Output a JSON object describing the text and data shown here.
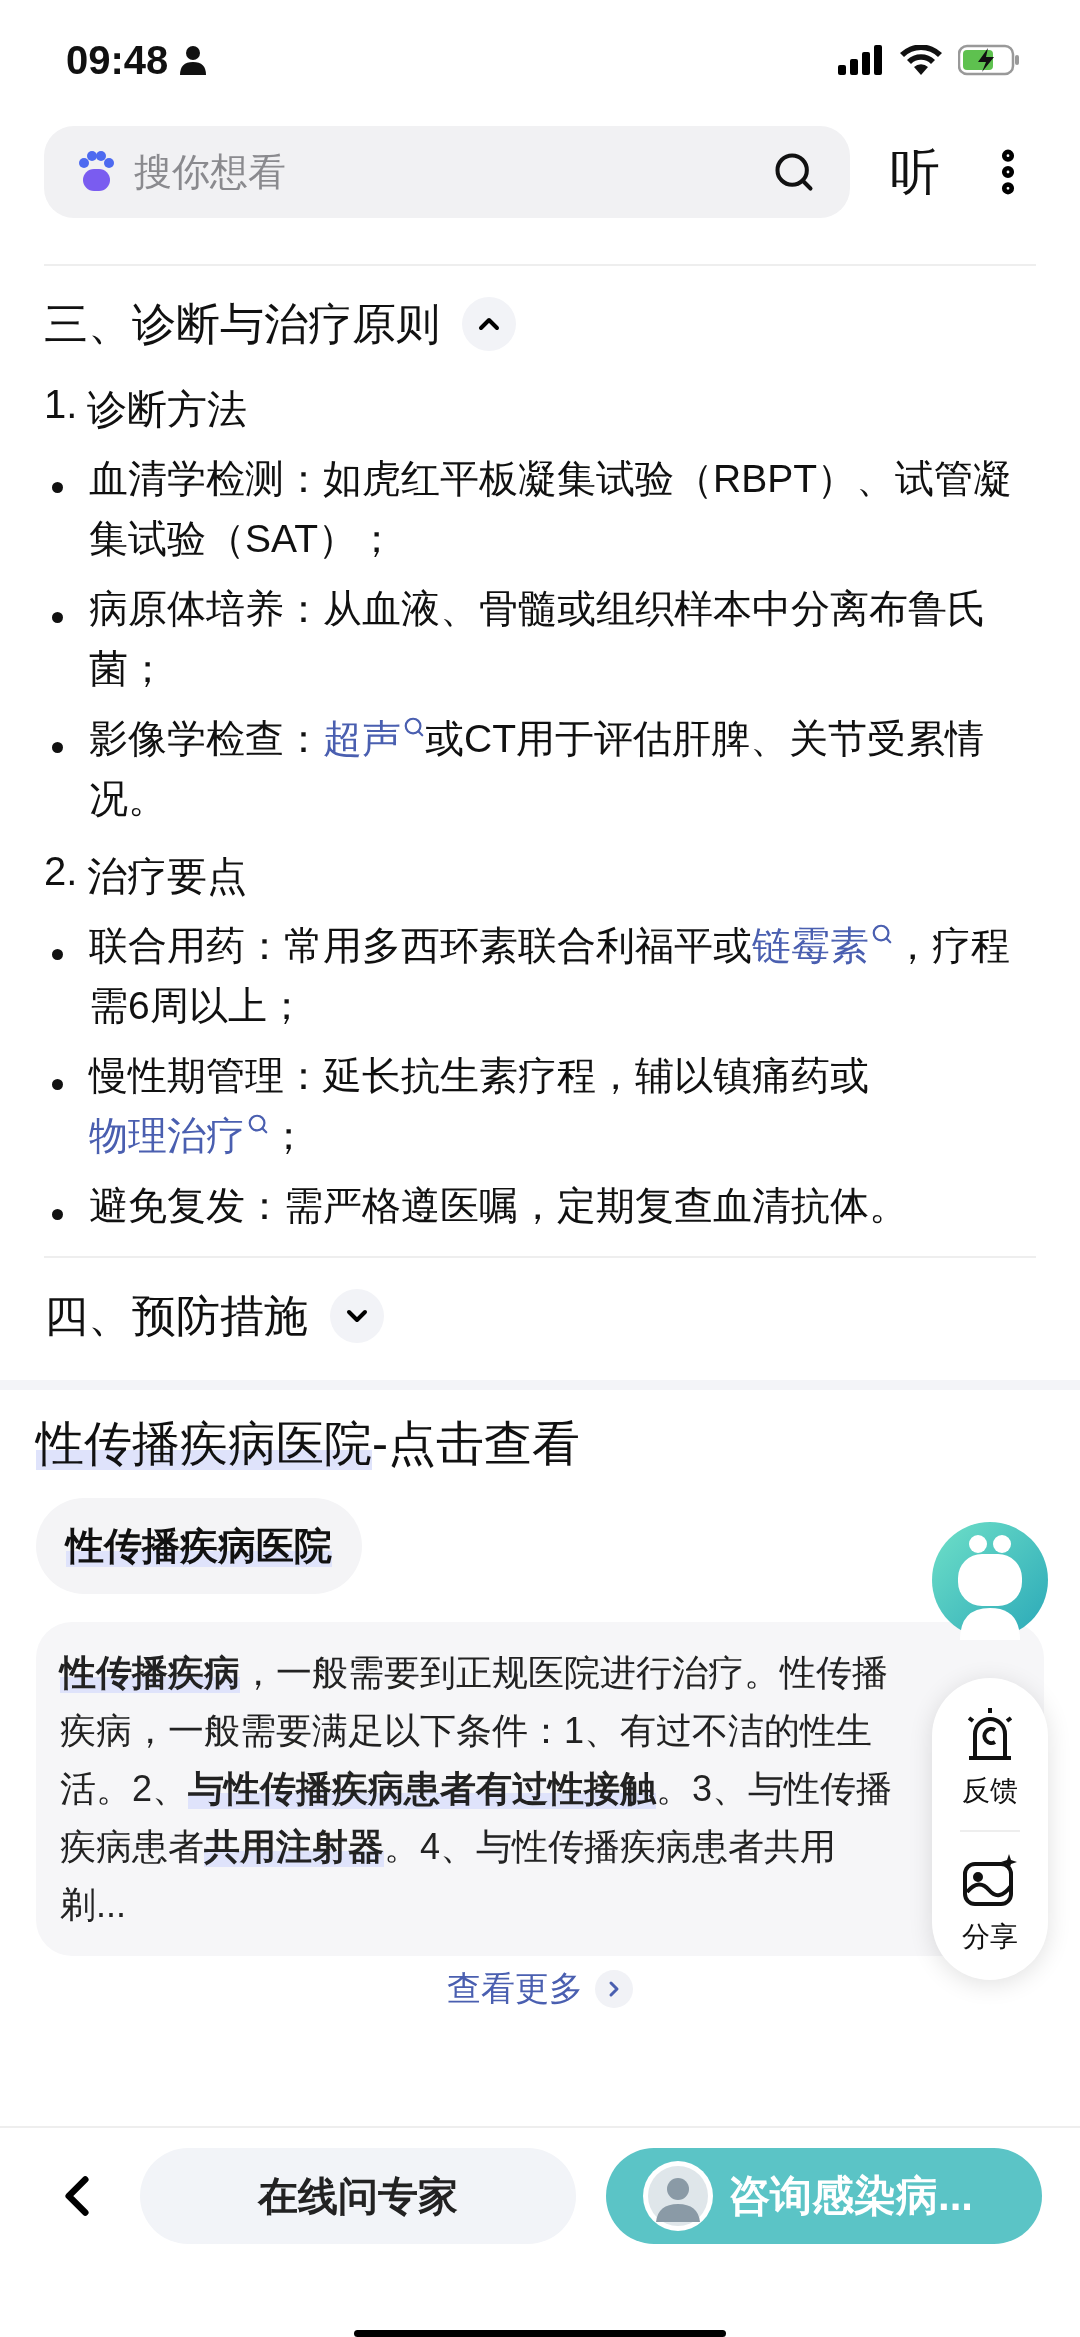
{
  "status_bar": {
    "time": "09:48"
  },
  "search": {
    "placeholder": "搜你想看",
    "listen": "听"
  },
  "sections": [
    {
      "title": "三、诊断与治疗原则",
      "expanded": true,
      "subsections": [
        {
          "number": "1.",
          "heading": "诊断方法",
          "items": [
            [
              {
                "kind": "text",
                "text": "血清学检测：如虎红平板凝集试验（RBPT）、试管凝集试验（SAT）；"
              }
            ],
            [
              {
                "kind": "text",
                "text": "病原体培养：从血液、骨髓或组织样本中分离布鲁氏菌；"
              }
            ],
            [
              {
                "kind": "text",
                "text": "影像学检查："
              },
              {
                "kind": "link",
                "text": "超声"
              },
              {
                "kind": "text",
                "text": "或CT用于评估肝脾、关节受累情况。"
              }
            ]
          ]
        },
        {
          "number": "2.",
          "heading": "治疗要点",
          "items": [
            [
              {
                "kind": "text",
                "text": "联合用药：常用多西环素联合利福平或"
              },
              {
                "kind": "link",
                "text": "链霉素"
              },
              {
                "kind": "text",
                "text": "，疗程需6周以上；"
              }
            ],
            [
              {
                "kind": "text",
                "text": "慢性期管理：延长抗生素疗程，辅以镇痛药或"
              },
              {
                "kind": "link",
                "text": "物理治疗"
              },
              {
                "kind": "text",
                "text": "；"
              }
            ],
            [
              {
                "kind": "text",
                "text": "避免复发：需严格遵医嘱，定期复查血清抗体。"
              }
            ]
          ]
        }
      ]
    },
    {
      "title": "四、预防措施",
      "expanded": false
    }
  ],
  "card": {
    "title": [
      {
        "text": "性传播疾病医院",
        "highlighted": true
      },
      {
        "text": "-点击查看",
        "highlighted": false
      }
    ],
    "chip": "性传播疾病医院",
    "paragraph": "**性传播疾病**，一般需要到正规医院进行治疗。性传播疾病，一般需要满足以下条件：1、有过不洁的性生活。2、**与性传播疾病患者有过性接触**。3、与性传播疾病患者**共用注射器**。4、与性传播疾病患者共用剃...",
    "more": "查看更多"
  },
  "float_panel": {
    "feedback": "反馈",
    "share": "分享"
  },
  "bottom_bar": {
    "ask": "在线问专家",
    "consult": "咨询感染病..."
  }
}
